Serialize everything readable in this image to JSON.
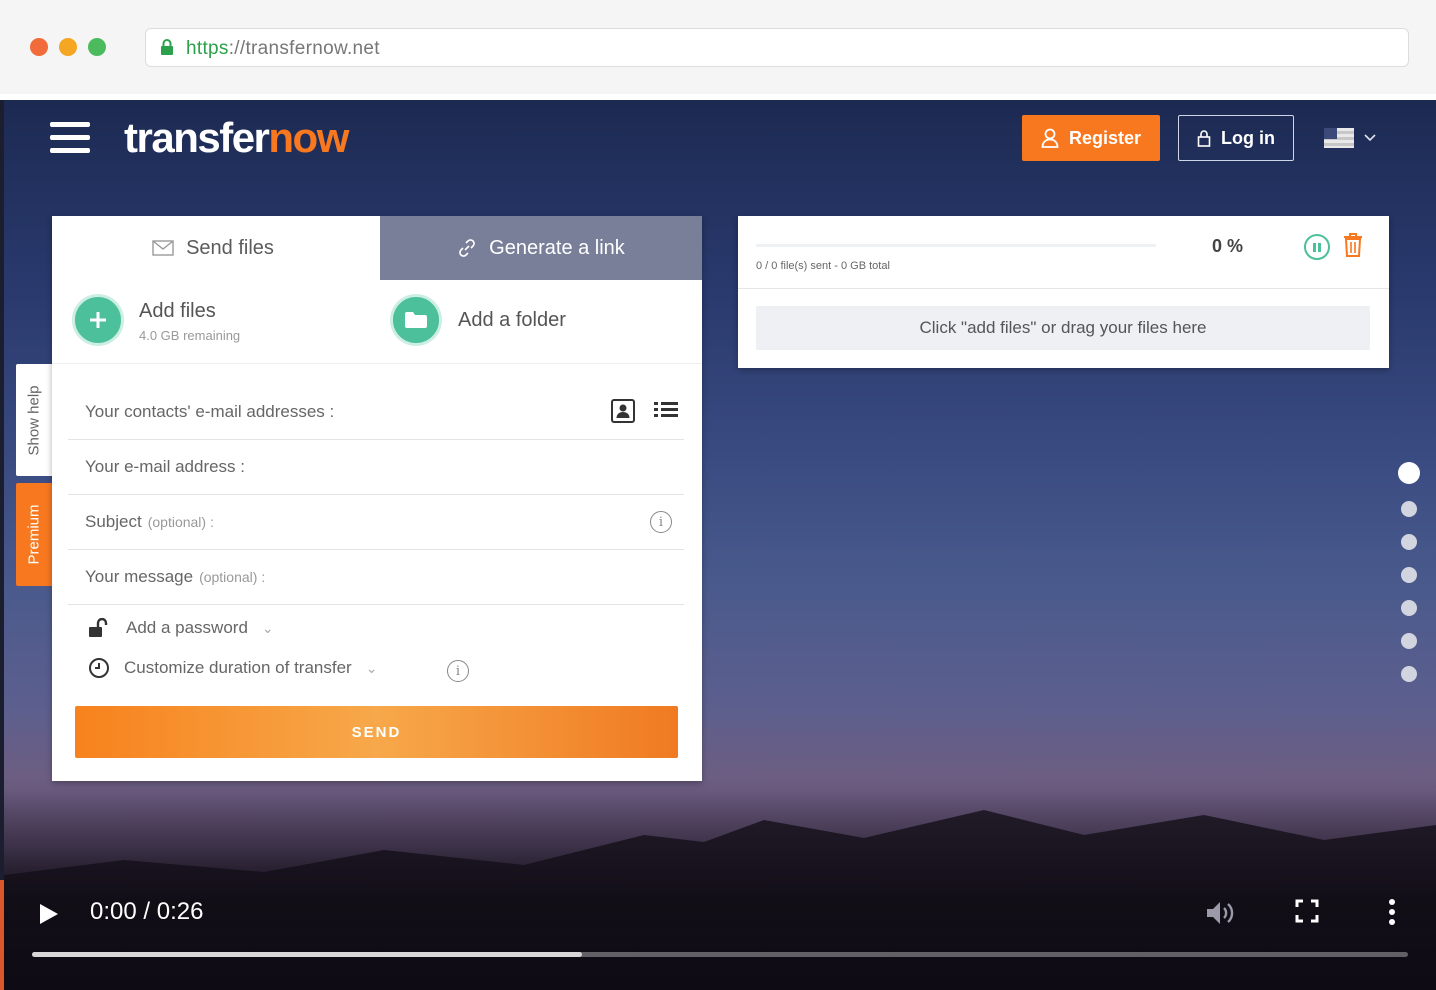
{
  "browser": {
    "url_protocol": "https",
    "url_rest": "://transfernow.net"
  },
  "header": {
    "logo_main": "transfer",
    "logo_accent": "now",
    "register_label": "Register",
    "login_label": "Log in"
  },
  "side_tabs": {
    "help_label": "Show help",
    "premium_label": "Premium"
  },
  "send_panel": {
    "tab_send_label": "Send files",
    "tab_link_label": "Generate a link",
    "add_files_label": "Add files",
    "add_files_remaining": "4.0 GB remaining",
    "add_folder_label": "Add a folder",
    "contacts_label": "Your contacts' e-mail addresses :",
    "email_label": "Your e-mail address :",
    "subject_label": "Subject",
    "subject_optional": "(optional) :",
    "message_label": "Your message",
    "message_optional": "(optional) :",
    "password_label": "Add a password",
    "duration_label": "Customize duration of transfer",
    "send_label": "SEND"
  },
  "status_panel": {
    "percent": "0 %",
    "progress_fraction": 0,
    "files_sent": "0 / 0 file(s) sent - 0 GB total",
    "drop_hint": "Click \"add files\" or drag your files here"
  },
  "slides": {
    "count": 7,
    "active_index": 0
  },
  "video": {
    "time": "0:00 / 0:26",
    "progress_fraction": 0.4
  },
  "colors": {
    "accent_orange": "#f7781f",
    "accent_green": "#4cc09a",
    "tab_inactive": "#797f99"
  }
}
